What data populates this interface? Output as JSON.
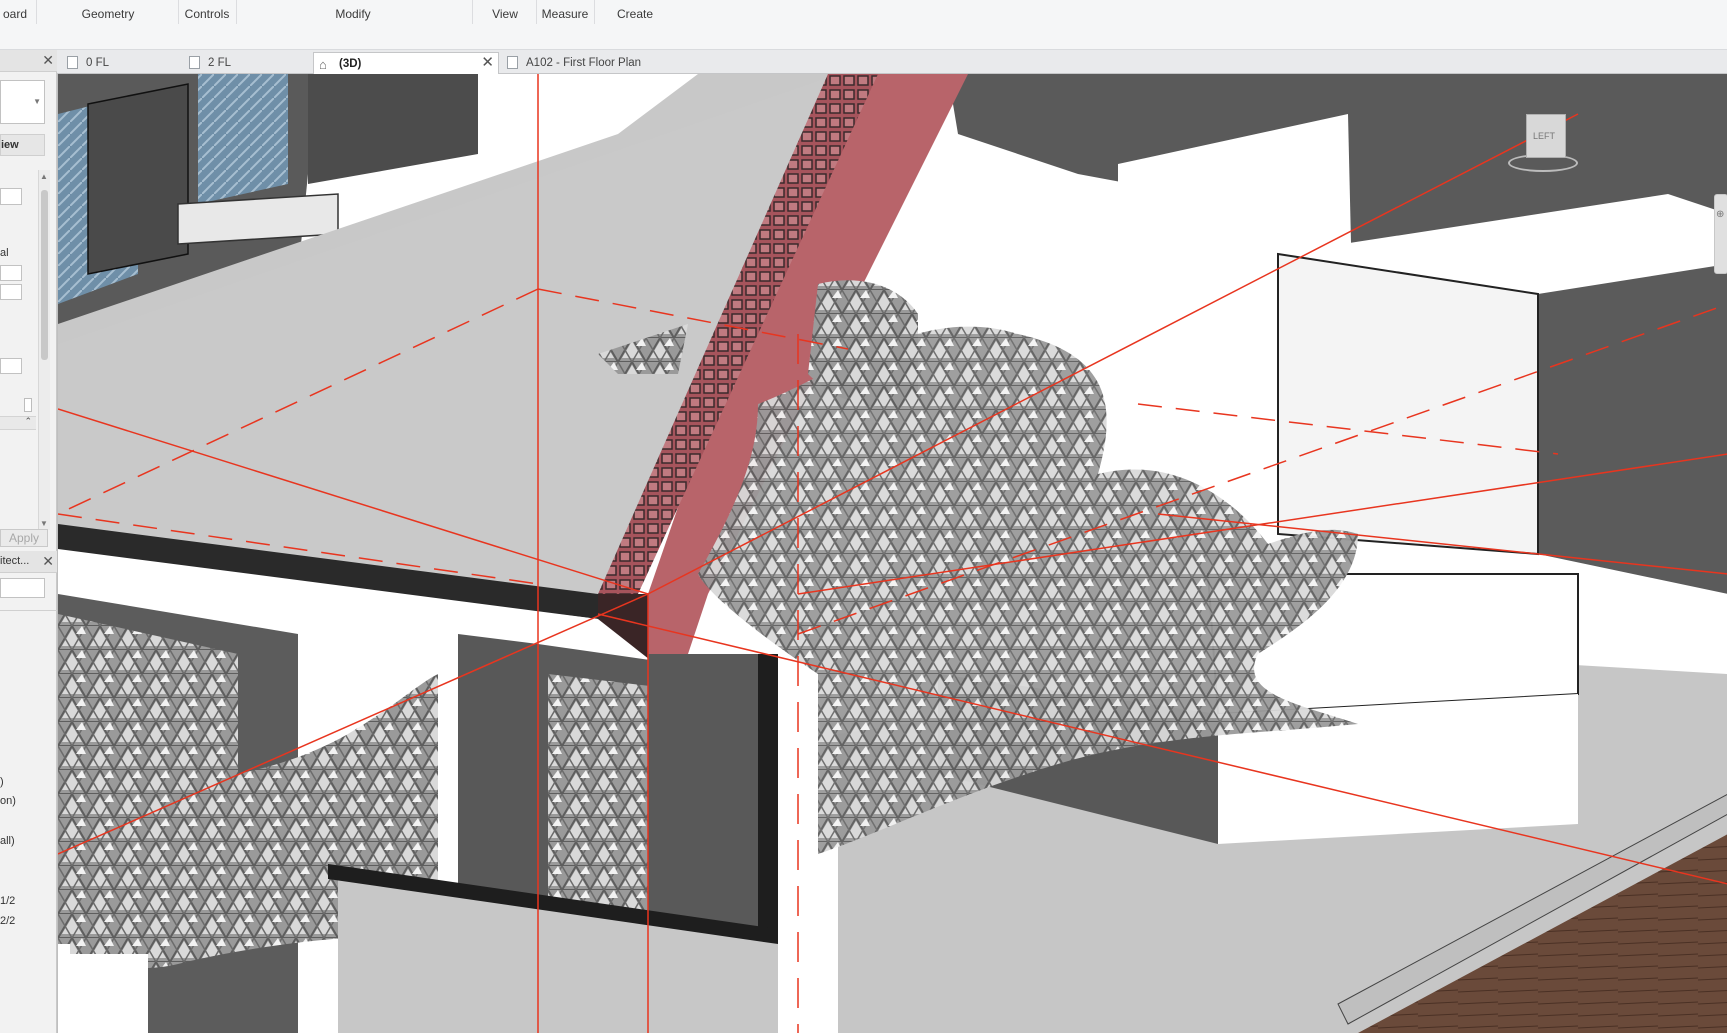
{
  "ribbon": {
    "panels": [
      "oard",
      "Geometry",
      "Controls",
      "Modify",
      "View",
      "Measure",
      "Create"
    ]
  },
  "tabs": [
    {
      "label": "0 FL",
      "icon": "floor-plan-icon"
    },
    {
      "label": "2 FL",
      "icon": "floor-plan-icon"
    },
    {
      "label": "(3D)",
      "icon": "home-3d-icon",
      "active": true
    },
    {
      "label": "A102 - First Floor Plan",
      "icon": "sheet-icon"
    }
  ],
  "properties": {
    "view_label": "iew",
    "partial_label": "al",
    "apply_label": "Apply"
  },
  "browser": {
    "title": "itect...",
    "items": [
      ")",
      "on)",
      "all)",
      "1/2",
      "2/2"
    ]
  },
  "viewcube": {
    "face_label": "LEFT"
  },
  "colors": {
    "grid_line": "#e8351f",
    "cut_wall": "#b8646a",
    "floor_slab": "#c9c9c9",
    "wall_dark": "#585858"
  }
}
